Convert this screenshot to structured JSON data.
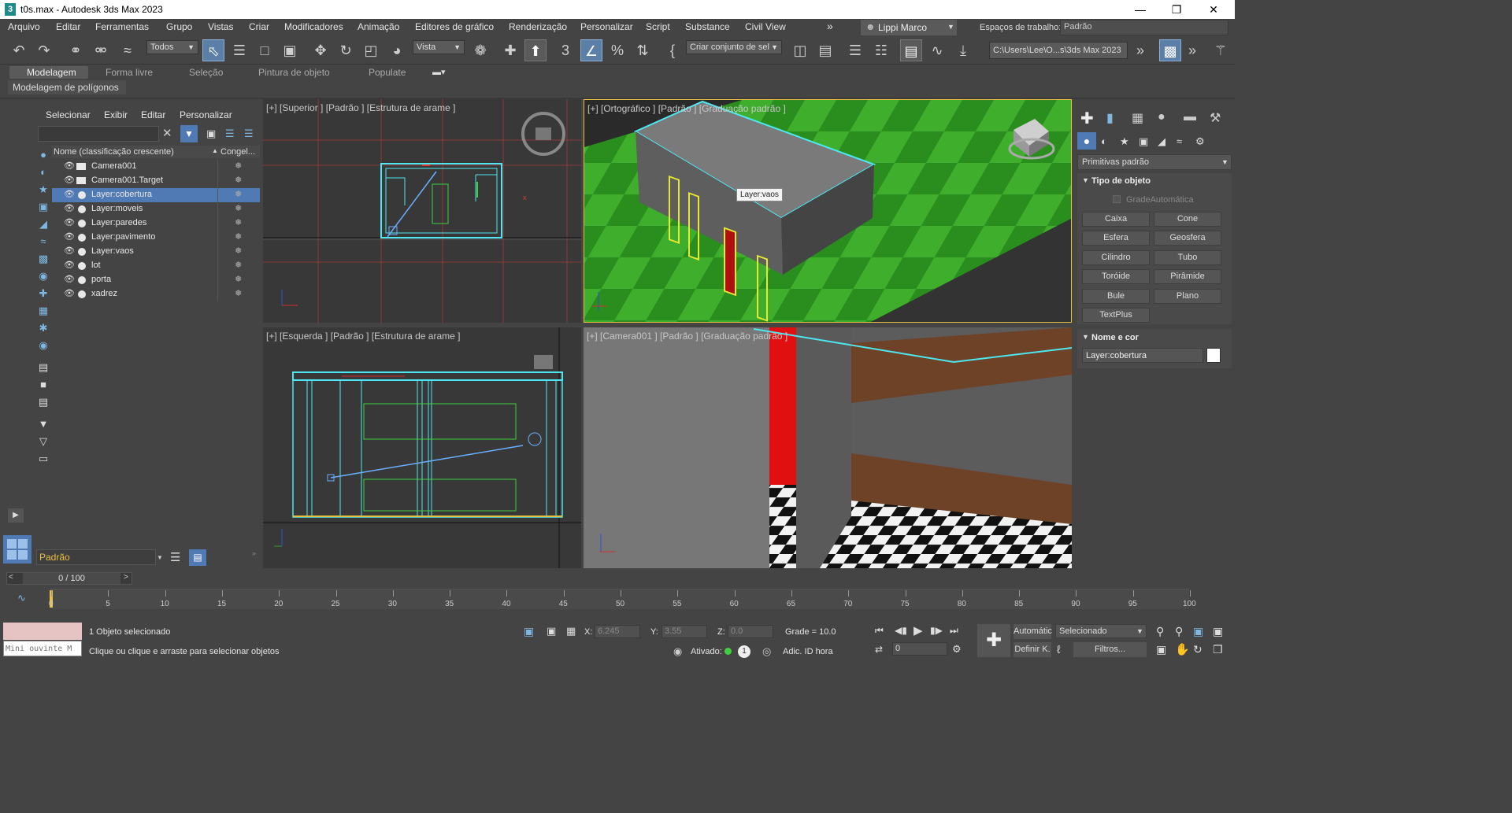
{
  "window": {
    "title": "t0s.max - Autodesk 3ds Max 2023",
    "app_icon": "3",
    "controls": [
      "minimize-icon",
      "maximize-icon",
      "close-icon"
    ]
  },
  "menubar": {
    "items": [
      "Arquivo",
      "Editar",
      "Ferramentas",
      "Grupo",
      "Vistas",
      "Criar",
      "Modificadores",
      "Animação",
      "Editores de gráfico",
      "Renderização",
      "Personalizar",
      "Script",
      "Substance",
      "Civil View"
    ],
    "user": "Lippi Marco",
    "workspace_label": "Espaços de trabalho:",
    "workspace_value": "Padrão"
  },
  "toolbar": {
    "selection_filter": "Todos",
    "ref_coord": "Vista",
    "named_selection": "Criar conjunto de sel",
    "project_path": "C:\\Users\\Lee\\O...s\\3ds Max 2023"
  },
  "ribbon": {
    "tabs": [
      "Modelagem",
      "Forma livre",
      "Seleção",
      "Pintura de objeto",
      "Populate"
    ],
    "active_tab": "Modelagem",
    "subpanel": "Modelagem de polígonos"
  },
  "scene_explorer": {
    "menu": [
      "Selecionar",
      "Exibir",
      "Editar",
      "Personalizar"
    ],
    "column_name": "Nome (classificação crescente)",
    "column_freeze": "Congel...",
    "rows": [
      {
        "label": "Camera001",
        "type": "camera",
        "selected": false
      },
      {
        "label": "Camera001.Target",
        "type": "camera",
        "selected": false
      },
      {
        "label": "Layer:cobertura",
        "type": "layer",
        "selected": true
      },
      {
        "label": "Layer:moveis",
        "type": "layer",
        "selected": false
      },
      {
        "label": "Layer:paredes",
        "type": "layer",
        "selected": false
      },
      {
        "label": "Layer:pavimento",
        "type": "layer",
        "selected": false
      },
      {
        "label": "Layer:vaos",
        "type": "layer",
        "selected": false
      },
      {
        "label": "lot",
        "type": "layer",
        "selected": false
      },
      {
        "label": "porta",
        "type": "layer",
        "selected": false
      },
      {
        "label": "xadrez",
        "type": "layer",
        "selected": false
      }
    ],
    "layer_field": "Padrão"
  },
  "viewports": {
    "top": {
      "label": "[+] [Superior ] [Padrão ] [Estrutura de arame ]"
    },
    "ortho": {
      "label": "[+] [Ortográfico ] [Padrão ] [Graduação padrão ]",
      "tooltip": "Layer:vaos"
    },
    "left": {
      "label": "[+] [Esquerda ] [Padrão ] [Estrutura de arame ]"
    },
    "camera": {
      "label": "[+] [Camera001 ] [Padrão ] [Graduação padrão ]"
    }
  },
  "command_panel": {
    "category": "Primitivas padrão",
    "rollout_object_type": "Tipo de objeto",
    "autogrid": "GradeAutomática",
    "buttons": [
      "Caixa",
      "Cone",
      "Esfera",
      "Geosfera",
      "Cilindro",
      "Tubo",
      "Toróide",
      "Pirâmide",
      "Bule",
      "Plano",
      "TextPlus"
    ],
    "rollout_name_color": "Nome e cor",
    "object_name": "Layer:cobertura",
    "object_color": "#ffffff"
  },
  "timeline": {
    "frame_display": "0 / 100",
    "ticks": [
      "0",
      "5",
      "10",
      "15",
      "20",
      "25",
      "30",
      "35",
      "40",
      "45",
      "50",
      "55",
      "60",
      "65",
      "70",
      "75",
      "80",
      "85",
      "90",
      "95",
      "100"
    ]
  },
  "status": {
    "maxscript_placeholder": "Mini ouvinte M",
    "selection_count": "1 Objeto selecionado",
    "prompt": "Clique ou clique e arraste para selecionar objetos",
    "x_label": "X:",
    "x_value": "6.245",
    "y_label": "Y:",
    "y_value": "3.55",
    "z_label": "Z:",
    "z_value": "0.0",
    "grid": "Grade = 10.0",
    "activated_label": "Ativado:",
    "add_time_tag": "Adic. ID hora",
    "auto_key": "Automátic",
    "set_key": "Definir K.",
    "key_mode": "Selecionado",
    "filters": "Filtros...",
    "current_frame": "0"
  }
}
